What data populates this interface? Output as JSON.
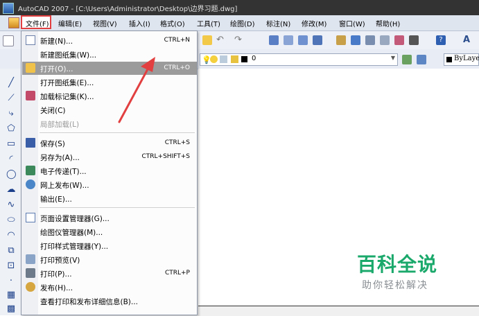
{
  "window": {
    "title": "AutoCAD 2007 - [C:\\Users\\Administrator\\Desktop\\边界习题.dwg]"
  },
  "menubar": {
    "items": [
      "文件(F)",
      "编辑(E)",
      "视图(V)",
      "插入(I)",
      "格式(O)",
      "工具(T)",
      "绘图(D)",
      "标注(N)",
      "修改(M)",
      "窗口(W)",
      "帮助(H)"
    ]
  },
  "layer": {
    "name": "0"
  },
  "linetype": {
    "value": "ByLaye"
  },
  "file_menu": {
    "items": [
      {
        "label": "新建(N)...",
        "shortcut": "CTRL+N",
        "icon": "new-file-icon"
      },
      {
        "label": "新建图纸集(W)...",
        "shortcut": "",
        "icon": ""
      },
      {
        "label": "打开(O)...",
        "shortcut": "CTRL+O",
        "icon": "open-folder-icon",
        "highlighted": true
      },
      {
        "label": "打开图纸集(E)...",
        "shortcut": "",
        "icon": ""
      },
      {
        "label": "加载标记集(K)...",
        "shortcut": "",
        "icon": "markup-icon"
      },
      {
        "label": "关闭(C)",
        "shortcut": "",
        "icon": ""
      },
      {
        "label": "局部加载(L)",
        "shortcut": "",
        "icon": "",
        "disabled": true
      },
      {
        "label": "保存(S)",
        "shortcut": "CTRL+S",
        "icon": "save-icon"
      },
      {
        "label": "另存为(A)...",
        "shortcut": "CTRL+SHIFT+S",
        "icon": ""
      },
      {
        "label": "电子传递(T)...",
        "shortcut": "",
        "icon": "etransmit-icon"
      },
      {
        "label": "网上发布(W)...",
        "shortcut": "",
        "icon": "web-publish-icon"
      },
      {
        "label": "输出(E)...",
        "shortcut": "",
        "icon": ""
      },
      {
        "label": "页面设置管理器(G)...",
        "shortcut": "",
        "icon": "page-setup-icon"
      },
      {
        "label": "绘图仪管理器(M)...",
        "shortcut": "",
        "icon": ""
      },
      {
        "label": "打印样式管理器(Y)...",
        "shortcut": "",
        "icon": ""
      },
      {
        "label": "打印预览(V)",
        "shortcut": "",
        "icon": "print-preview-icon"
      },
      {
        "label": "打印(P)...",
        "shortcut": "CTRL+P",
        "icon": "print-icon"
      },
      {
        "label": "发布(H)...",
        "shortcut": "",
        "icon": "publish-icon"
      },
      {
        "label": "查看打印和发布详细信息(B)...",
        "shortcut": "",
        "icon": ""
      }
    ]
  },
  "watermark": {
    "title": "百科全说",
    "subtitle": "助你轻松解决"
  },
  "colors": {
    "highlight": "#9b9b9b",
    "annotation_red": "#e24040",
    "watermark_green": "#1aa86b"
  }
}
